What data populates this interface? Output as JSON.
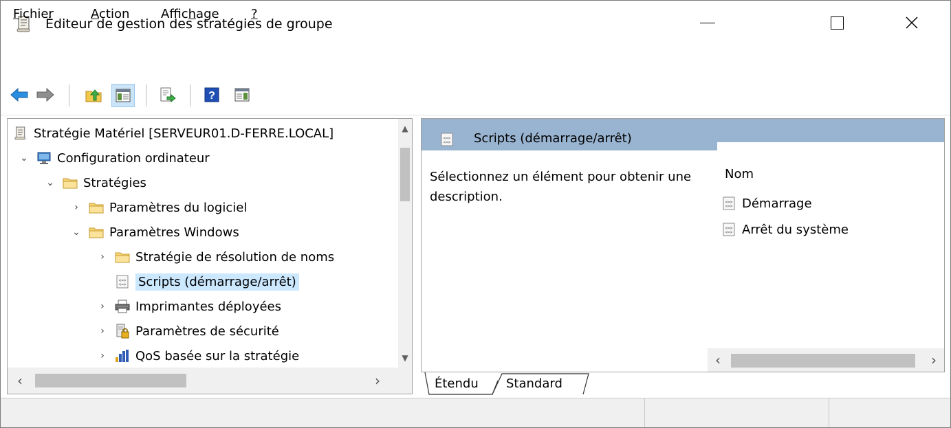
{
  "window": {
    "title": "Éditeur de gestion des stratégies de groupe",
    "icon": "policy-scroll-icon"
  },
  "menu": {
    "fichier": {
      "accel": "F",
      "rest": "ichier"
    },
    "action": {
      "accel": "A",
      "rest": "ction"
    },
    "affichage": {
      "pre": "Affic",
      "accel": "h",
      "post": "age"
    },
    "help": "?"
  },
  "toolbar": {
    "icons": [
      "back-arrow-icon",
      "forward-arrow-icon",
      "up-folder-icon",
      "show-hide-tree-icon",
      "export-list-icon",
      "help-icon",
      "action-pane-icon"
    ]
  },
  "tree": {
    "root": "Stratégie Matériel [SERVEUR01.D-FERRE.LOCAL]",
    "items": [
      {
        "label": "Configuration ordinateur",
        "chevron": "expanded",
        "icon": "computer-icon"
      },
      {
        "label": "Stratégies",
        "chevron": "expanded",
        "icon": "folder-icon"
      },
      {
        "label": "Paramètres du logiciel",
        "chevron": "collapsed",
        "icon": "folder-icon"
      },
      {
        "label": "Paramètres Windows",
        "chevron": "expanded",
        "icon": "folder-icon"
      },
      {
        "label": "Stratégie de résolution de noms",
        "chevron": "collapsed",
        "icon": "folder-icon"
      },
      {
        "label": "Scripts (démarrage/arrêt)",
        "chevron": "none",
        "icon": "script-icon",
        "selected": true
      },
      {
        "label": "Imprimantes déployées",
        "chevron": "collapsed",
        "icon": "printer-icon"
      },
      {
        "label": "Paramètres de sécurité",
        "chevron": "collapsed",
        "icon": "security-icon"
      },
      {
        "label": "QoS basée sur la stratégie",
        "chevron": "collapsed",
        "icon": "qos-chart-icon"
      }
    ]
  },
  "details": {
    "header": "Scripts (démarrage/arrêt)",
    "description": "Sélectionnez un élément pour obtenir une description.",
    "column": "Nom",
    "items": [
      "Démarrage",
      "Arrêt du système"
    ]
  },
  "tabs": {
    "extended": "Étendu",
    "standard": "Standard"
  },
  "colors": {
    "header_band": "#99b4d1",
    "selection": "#cce8ff"
  }
}
